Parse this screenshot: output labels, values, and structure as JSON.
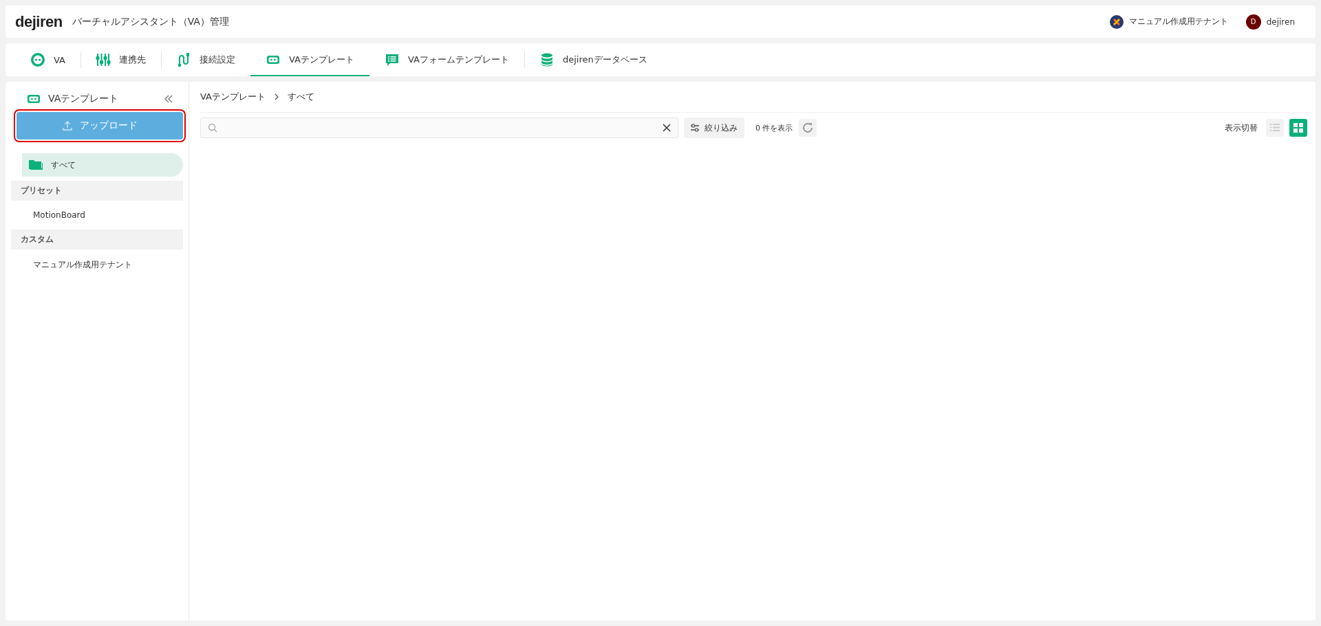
{
  "header": {
    "logo": "dejiren",
    "title": "バーチャルアシスタント（VA）管理",
    "tenant": "マニュアル作成用テナント",
    "user_initial": "D",
    "user": "dejiren"
  },
  "tabs": [
    {
      "label": "VA",
      "kind": "robot",
      "selected": false
    },
    {
      "label": "連携先",
      "kind": "sliders",
      "selected": false
    },
    {
      "label": "接続設定",
      "kind": "cable",
      "selected": false
    },
    {
      "label": "VAテンプレート",
      "kind": "template",
      "selected": true
    },
    {
      "label": "VAフォームテンプレート",
      "kind": "form",
      "selected": false
    },
    {
      "label": "dejirenデータベース",
      "kind": "database",
      "selected": false
    }
  ],
  "sidebar": {
    "title": "VAテンプレート",
    "upload_button": "アップロード",
    "all": {
      "label": "すべて",
      "selected": true
    },
    "sections": [
      {
        "heading": "プリセット",
        "items": [
          {
            "label": "MotionBoard",
            "selected": false
          }
        ]
      },
      {
        "heading": "カスタム",
        "items": [
          {
            "label": "マニュアル作成用テナント",
            "selected": false
          }
        ]
      }
    ]
  },
  "breadcrumb": [
    "VAテンプレート",
    "すべて"
  ],
  "toolbar": {
    "filter_button": "絞り込み",
    "count": "0 件を表示",
    "view_label": "表示切替",
    "views": [
      {
        "kind": "list",
        "selected": false
      },
      {
        "kind": "grid",
        "selected": true
      }
    ]
  }
}
